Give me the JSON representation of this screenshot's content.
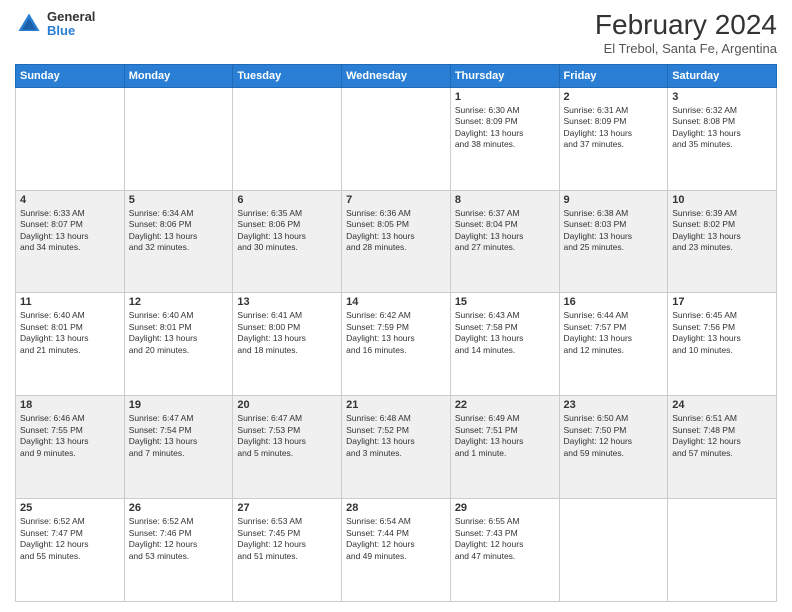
{
  "logo": {
    "general": "General",
    "blue": "Blue"
  },
  "title": "February 2024",
  "subtitle": "El Trebol, Santa Fe, Argentina",
  "headers": [
    "Sunday",
    "Monday",
    "Tuesday",
    "Wednesday",
    "Thursday",
    "Friday",
    "Saturday"
  ],
  "weeks": [
    [
      {
        "day": "",
        "info": ""
      },
      {
        "day": "",
        "info": ""
      },
      {
        "day": "",
        "info": ""
      },
      {
        "day": "",
        "info": ""
      },
      {
        "day": "1",
        "info": "Sunrise: 6:30 AM\nSunset: 8:09 PM\nDaylight: 13 hours\nand 38 minutes."
      },
      {
        "day": "2",
        "info": "Sunrise: 6:31 AM\nSunset: 8:09 PM\nDaylight: 13 hours\nand 37 minutes."
      },
      {
        "day": "3",
        "info": "Sunrise: 6:32 AM\nSunset: 8:08 PM\nDaylight: 13 hours\nand 35 minutes."
      }
    ],
    [
      {
        "day": "4",
        "info": "Sunrise: 6:33 AM\nSunset: 8:07 PM\nDaylight: 13 hours\nand 34 minutes."
      },
      {
        "day": "5",
        "info": "Sunrise: 6:34 AM\nSunset: 8:06 PM\nDaylight: 13 hours\nand 32 minutes."
      },
      {
        "day": "6",
        "info": "Sunrise: 6:35 AM\nSunset: 8:06 PM\nDaylight: 13 hours\nand 30 minutes."
      },
      {
        "day": "7",
        "info": "Sunrise: 6:36 AM\nSunset: 8:05 PM\nDaylight: 13 hours\nand 28 minutes."
      },
      {
        "day": "8",
        "info": "Sunrise: 6:37 AM\nSunset: 8:04 PM\nDaylight: 13 hours\nand 27 minutes."
      },
      {
        "day": "9",
        "info": "Sunrise: 6:38 AM\nSunset: 8:03 PM\nDaylight: 13 hours\nand 25 minutes."
      },
      {
        "day": "10",
        "info": "Sunrise: 6:39 AM\nSunset: 8:02 PM\nDaylight: 13 hours\nand 23 minutes."
      }
    ],
    [
      {
        "day": "11",
        "info": "Sunrise: 6:40 AM\nSunset: 8:01 PM\nDaylight: 13 hours\nand 21 minutes."
      },
      {
        "day": "12",
        "info": "Sunrise: 6:40 AM\nSunset: 8:01 PM\nDaylight: 13 hours\nand 20 minutes."
      },
      {
        "day": "13",
        "info": "Sunrise: 6:41 AM\nSunset: 8:00 PM\nDaylight: 13 hours\nand 18 minutes."
      },
      {
        "day": "14",
        "info": "Sunrise: 6:42 AM\nSunset: 7:59 PM\nDaylight: 13 hours\nand 16 minutes."
      },
      {
        "day": "15",
        "info": "Sunrise: 6:43 AM\nSunset: 7:58 PM\nDaylight: 13 hours\nand 14 minutes."
      },
      {
        "day": "16",
        "info": "Sunrise: 6:44 AM\nSunset: 7:57 PM\nDaylight: 13 hours\nand 12 minutes."
      },
      {
        "day": "17",
        "info": "Sunrise: 6:45 AM\nSunset: 7:56 PM\nDaylight: 13 hours\nand 10 minutes."
      }
    ],
    [
      {
        "day": "18",
        "info": "Sunrise: 6:46 AM\nSunset: 7:55 PM\nDaylight: 13 hours\nand 9 minutes."
      },
      {
        "day": "19",
        "info": "Sunrise: 6:47 AM\nSunset: 7:54 PM\nDaylight: 13 hours\nand 7 minutes."
      },
      {
        "day": "20",
        "info": "Sunrise: 6:47 AM\nSunset: 7:53 PM\nDaylight: 13 hours\nand 5 minutes."
      },
      {
        "day": "21",
        "info": "Sunrise: 6:48 AM\nSunset: 7:52 PM\nDaylight: 13 hours\nand 3 minutes."
      },
      {
        "day": "22",
        "info": "Sunrise: 6:49 AM\nSunset: 7:51 PM\nDaylight: 13 hours\nand 1 minute."
      },
      {
        "day": "23",
        "info": "Sunrise: 6:50 AM\nSunset: 7:50 PM\nDaylight: 12 hours\nand 59 minutes."
      },
      {
        "day": "24",
        "info": "Sunrise: 6:51 AM\nSunset: 7:48 PM\nDaylight: 12 hours\nand 57 minutes."
      }
    ],
    [
      {
        "day": "25",
        "info": "Sunrise: 6:52 AM\nSunset: 7:47 PM\nDaylight: 12 hours\nand 55 minutes."
      },
      {
        "day": "26",
        "info": "Sunrise: 6:52 AM\nSunset: 7:46 PM\nDaylight: 12 hours\nand 53 minutes."
      },
      {
        "day": "27",
        "info": "Sunrise: 6:53 AM\nSunset: 7:45 PM\nDaylight: 12 hours\nand 51 minutes."
      },
      {
        "day": "28",
        "info": "Sunrise: 6:54 AM\nSunset: 7:44 PM\nDaylight: 12 hours\nand 49 minutes."
      },
      {
        "day": "29",
        "info": "Sunrise: 6:55 AM\nSunset: 7:43 PM\nDaylight: 12 hours\nand 47 minutes."
      },
      {
        "day": "",
        "info": ""
      },
      {
        "day": "",
        "info": ""
      }
    ]
  ]
}
